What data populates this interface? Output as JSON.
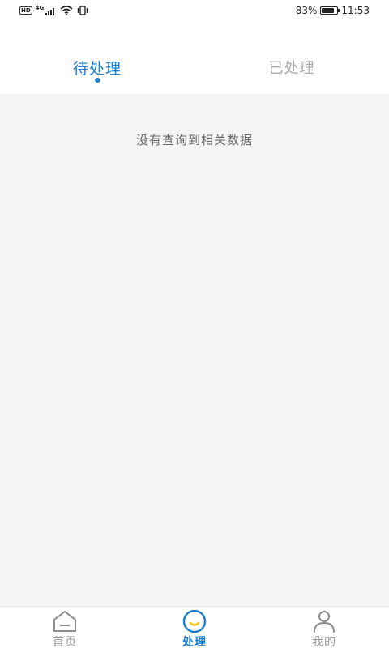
{
  "status_bar": {
    "left_badges": [
      "HD",
      "4G"
    ],
    "battery_percent_text": "83%",
    "battery_level": 0.83,
    "time": "11:53"
  },
  "tabs": [
    {
      "label": "待处理",
      "active": true
    },
    {
      "label": "已处理",
      "active": false
    }
  ],
  "content": {
    "empty_message": "没有查询到相关数据"
  },
  "bottom_nav": {
    "items": [
      {
        "label": "首页",
        "icon": "home-icon",
        "active": false
      },
      {
        "label": "处理",
        "icon": "process-icon",
        "active": true
      },
      {
        "label": "我的",
        "icon": "user-icon",
        "active": false
      }
    ]
  },
  "colors": {
    "accent": "#1e7ccc",
    "accent_yellow": "#f5c518",
    "inactive": "#aaaaaa",
    "background": "#f5f5f5"
  }
}
